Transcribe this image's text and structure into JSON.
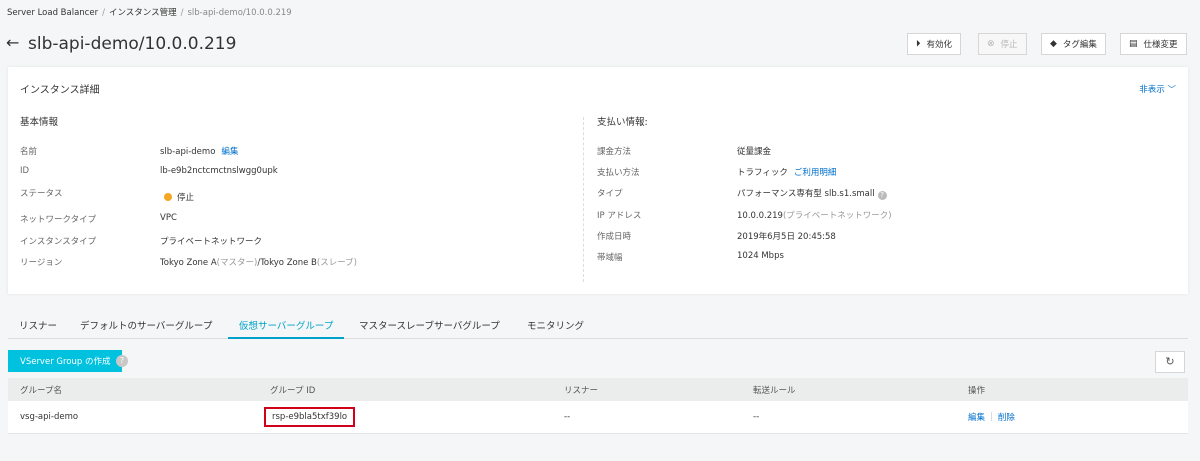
{
  "breadcrumb": [
    "Server Load Balancer",
    "インスタンス管理",
    "slb-api-demo/10.0.0.219"
  ],
  "title": "slb-api-demo/10.0.0.219",
  "toolbar": {
    "enable_label": "有効化",
    "stop_label": "停止",
    "tag_edit_label": "タグ編集",
    "spec_change_label": "仕様変更"
  },
  "details": {
    "title": "インスタンス詳細",
    "hide_label": "非表示",
    "basic": {
      "title": "基本情報",
      "name_key": "名前",
      "name_value": "slb-api-demo",
      "name_edit": "編集",
      "id_key": "ID",
      "id_value": "lb-e9b2nctcmctnslwgg0upk",
      "status_key": "ステータス",
      "status_value": "停止",
      "status_color": "#f5a623",
      "network_type_key": "ネットワークタイプ",
      "network_type_value": "VPC",
      "instance_type_key": "インスタンスタイプ",
      "instance_type_value": "プライベートネットワーク",
      "region_key": "リージョン",
      "region_main": "Tokyo Zone A",
      "region_main_role": "(マスター)",
      "region_slash": "/",
      "region_sub": "Tokyo Zone B",
      "region_sub_role": "(スレーブ)"
    },
    "billing": {
      "title": "支払い情報:",
      "billing_method_key": "課金方法",
      "billing_method_value": "従量課金",
      "payment_method_key": "支払い方法",
      "payment_method_value": "トラフィック",
      "payment_detail_link": "ご利用明細",
      "type_key": "タイプ",
      "type_value": "パフォーマンス専有型",
      "type_spec": "slb.s1.small",
      "ip_key": "IP アドレス",
      "ip_value": "10.0.0.219",
      "ip_note": "(プライベートネットワーク)",
      "created_key": "作成日時",
      "created_value": "2019年6月5日 20:45:58",
      "bandwidth_key": "帯域幅",
      "bandwidth_value": "1024 Mbps"
    }
  },
  "tabs": [
    "リスナー",
    "デフォルトのサーバーグループ",
    "仮想サーバーグループ",
    "マスタースレーブサーバグループ",
    "モニタリング"
  ],
  "active_tab": 2,
  "create_button_label": "VServer Group の作成",
  "table": {
    "headers": [
      "グループ名",
      "グループ ID",
      "リスナー",
      "転送ルール",
      "操作"
    ],
    "rows": [
      {
        "group_name": "vsg-api-demo",
        "group_id": "rsp-e9bla5txf39lo",
        "listener": "--",
        "forward_rule": "--",
        "edit": "編集",
        "delete": "削除"
      }
    ]
  },
  "colors": {
    "accent": "#00c1de",
    "link": "#0070cc",
    "highlight_box": "#d0021b",
    "status_stopped": "#f5a623"
  }
}
